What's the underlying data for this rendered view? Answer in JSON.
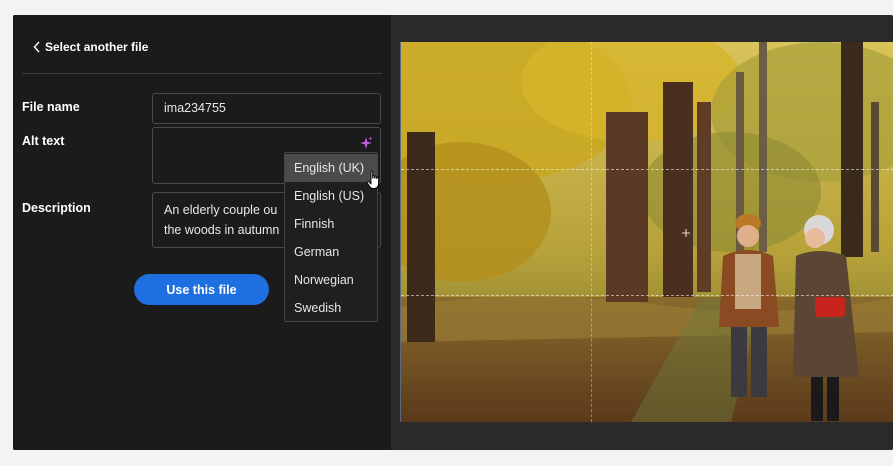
{
  "header": {
    "back_label": "Select another file"
  },
  "form": {
    "file_name_label": "File name",
    "file_name_value": "ima234755",
    "alt_text_label": "Alt text",
    "alt_text_value": "",
    "description_label": "Description",
    "description_value": "An elderly couple ou\nthe woods in autumn"
  },
  "actions": {
    "use_file_label": "Use this file"
  },
  "language_menu": {
    "items": [
      "English (UK)",
      "English (US)",
      "Finnish",
      "German",
      "Norwegian",
      "Swedish"
    ],
    "highlighted": "English (UK)"
  },
  "colors": {
    "accent": "#1e6fe0",
    "sparkle": "#c05ce8",
    "panel": "#1b1b1b"
  },
  "icons": {
    "back": "chevron-left-icon",
    "ai": "sparkle-icon",
    "cursor": "hand-pointer-icon"
  }
}
